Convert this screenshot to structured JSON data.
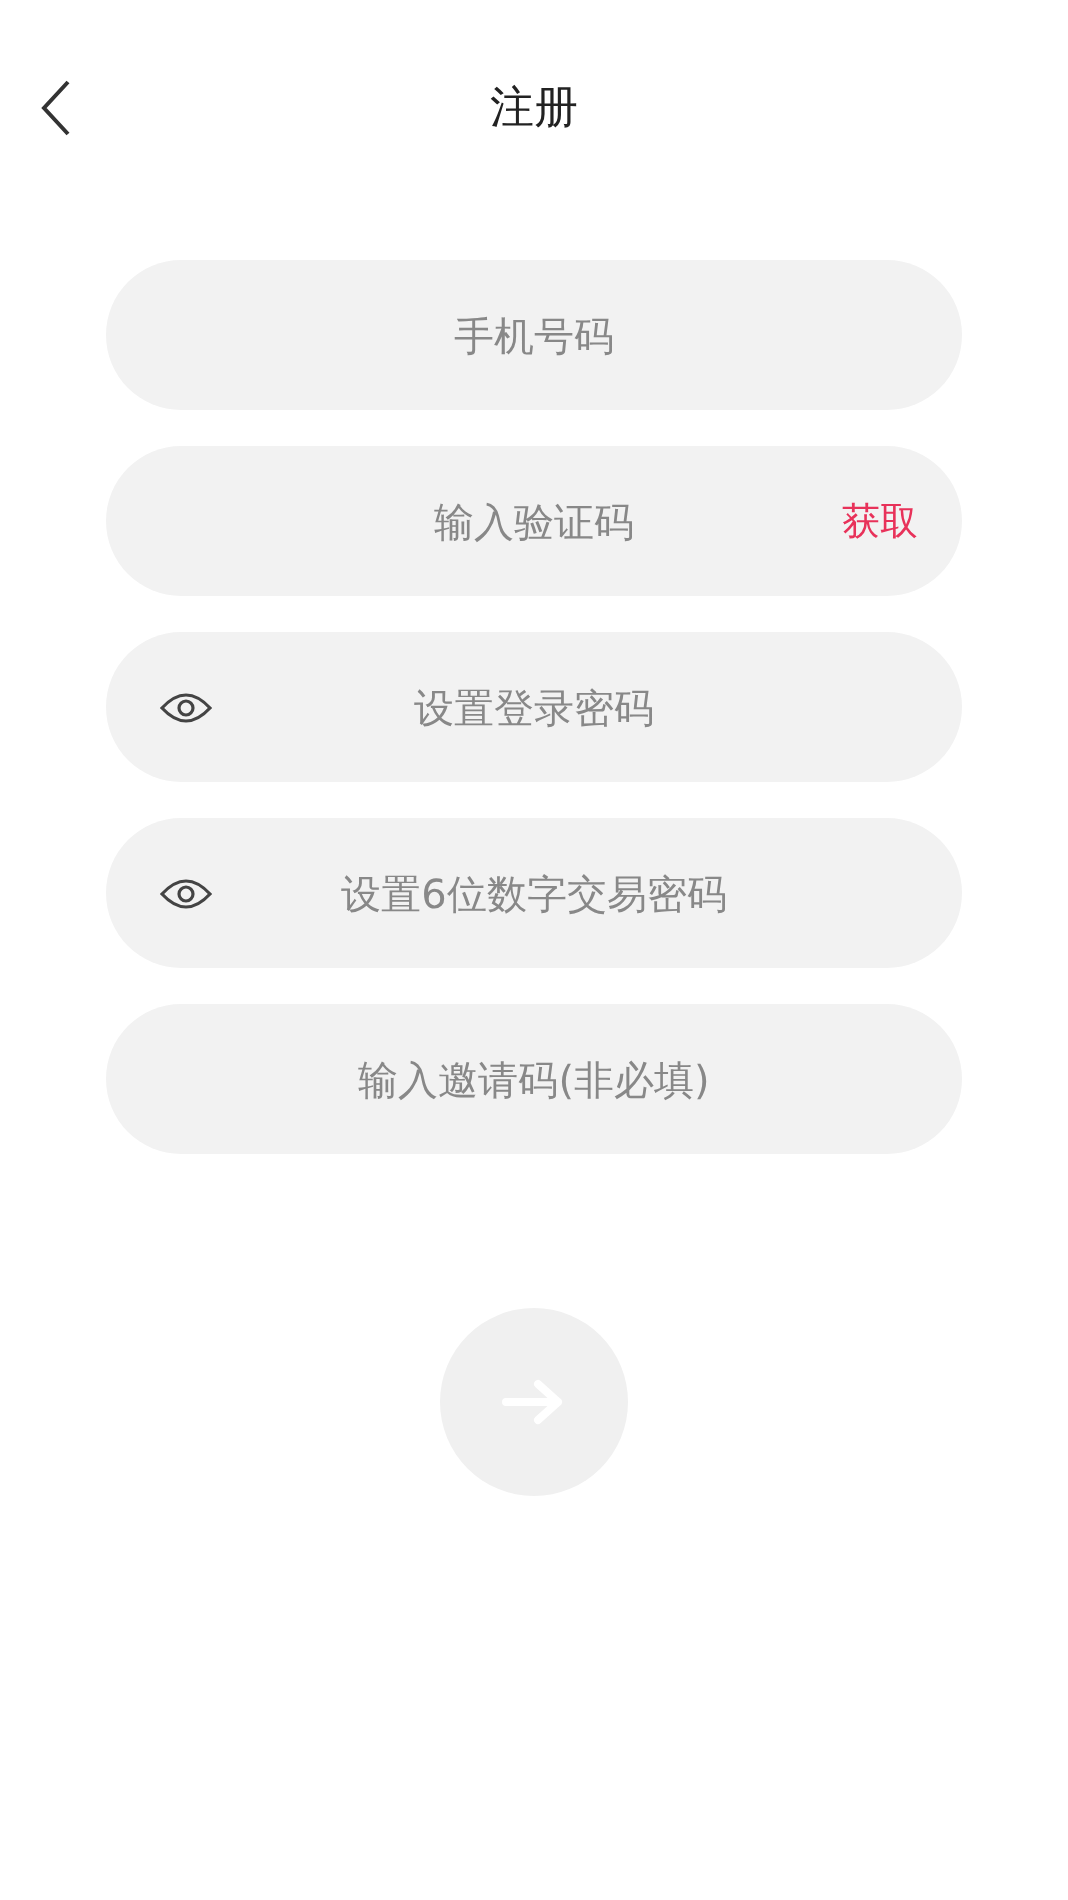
{
  "header": {
    "title": "注册"
  },
  "fields": [
    {
      "kind": "plain",
      "placeholder": "手机号码"
    },
    {
      "kind": "code",
      "placeholder": "输入验证码",
      "action": "获取"
    },
    {
      "kind": "password",
      "placeholder": "设置登录密码"
    },
    {
      "kind": "password",
      "placeholder": "设置6位数字交易密码"
    },
    {
      "kind": "plain",
      "placeholder": "输入邀请码(非必填)"
    }
  ]
}
